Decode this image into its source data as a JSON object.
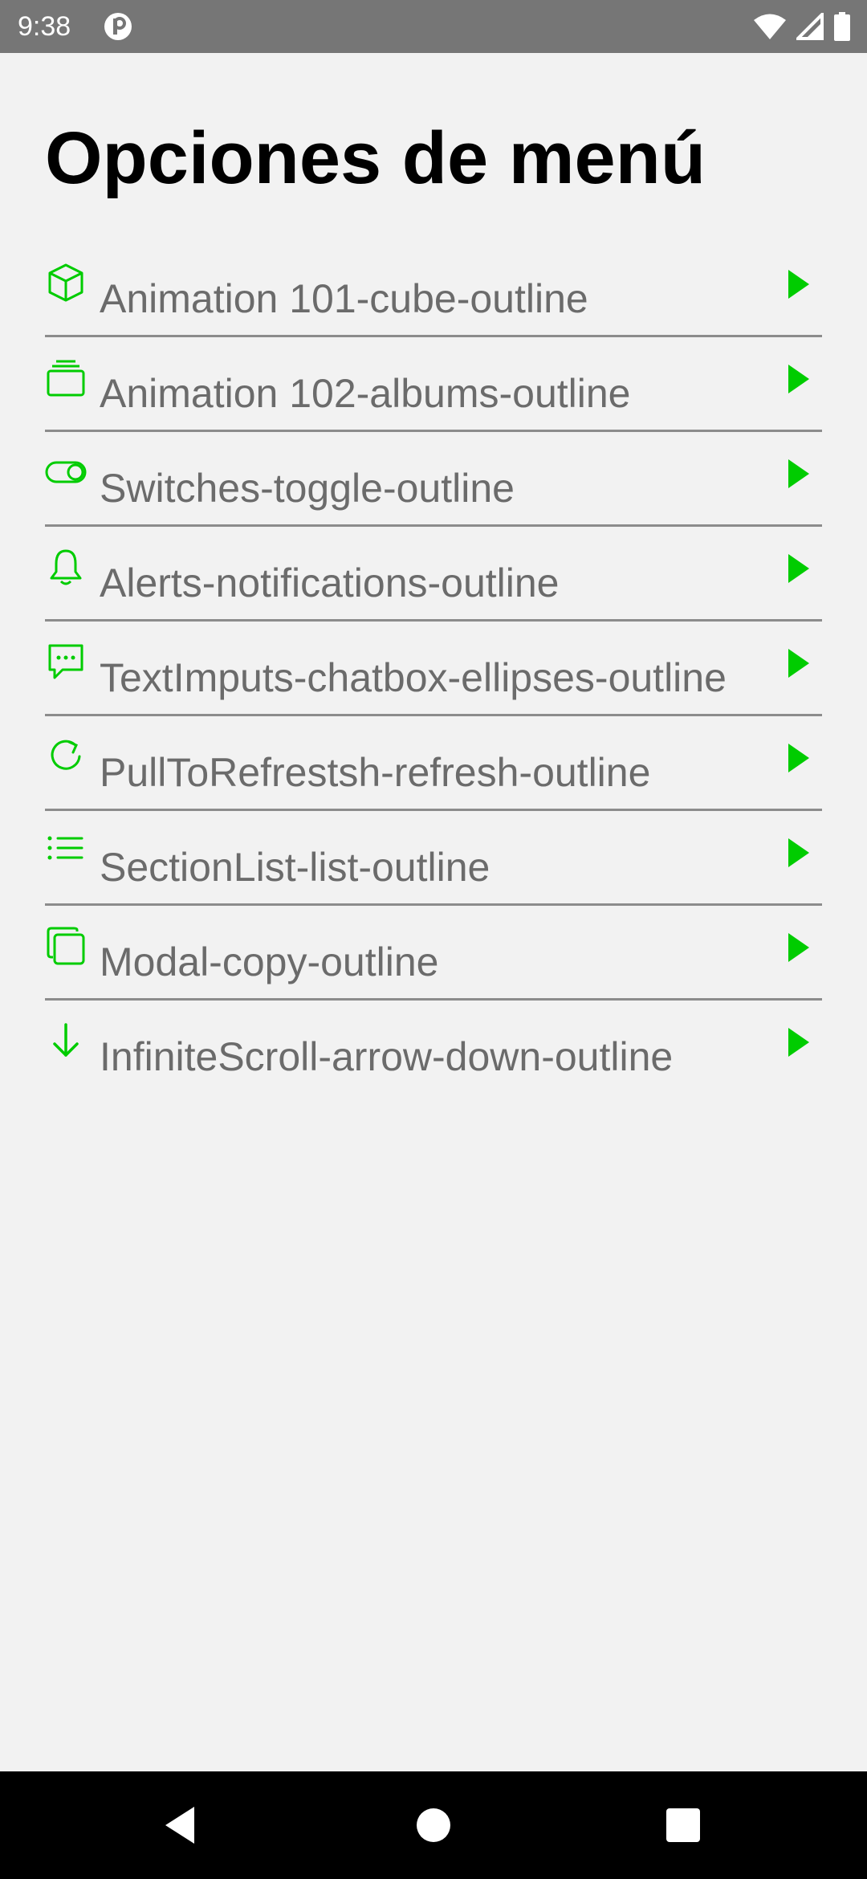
{
  "status_bar": {
    "time": "9:38"
  },
  "page": {
    "title": "Opciones de menú"
  },
  "colors": {
    "accent": "#00cc00",
    "status_bar_bg": "#767676",
    "background": "#f2f2f2",
    "label_text": "#6b6b6b",
    "divider": "#8c8c8c"
  },
  "menu": {
    "items": [
      {
        "label": "Animation 101-cube-outline",
        "icon": "cube-outline-icon"
      },
      {
        "label": "Animation 102-albums-outline",
        "icon": "albums-outline-icon"
      },
      {
        "label": "Switches-toggle-outline",
        "icon": "toggle-outline-icon"
      },
      {
        "label": "Alerts-notifications-outline",
        "icon": "notifications-outline-icon"
      },
      {
        "label": "TextImputs-chatbox-ellipses-outline",
        "icon": "chatbox-ellipses-outline-icon"
      },
      {
        "label": "PullToRefrestsh-refresh-outline",
        "icon": "refresh-outline-icon"
      },
      {
        "label": "SectionList-list-outline",
        "icon": "list-outline-icon"
      },
      {
        "label": "Modal-copy-outline",
        "icon": "copy-outline-icon"
      },
      {
        "label": "InfiniteScroll-arrow-down-outline",
        "icon": "arrow-down-outline-icon"
      }
    ]
  },
  "nav_bar": {
    "buttons": [
      "back-icon",
      "home-icon",
      "recents-icon"
    ]
  }
}
